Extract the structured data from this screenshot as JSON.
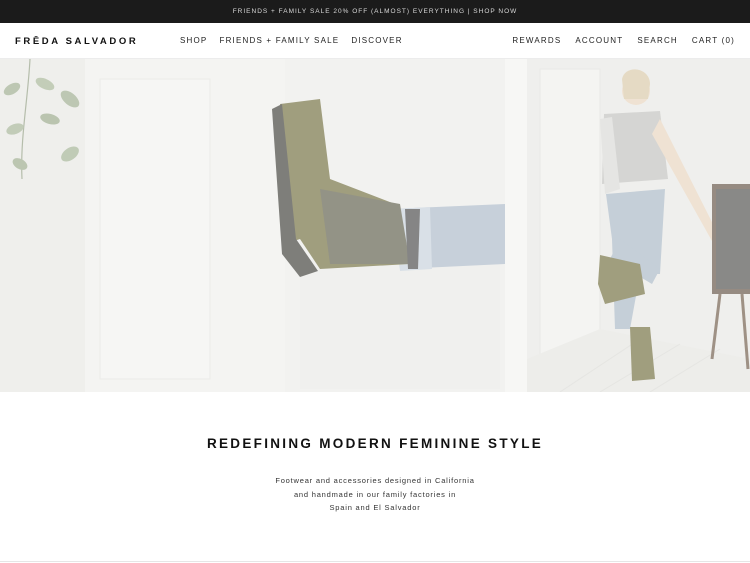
{
  "promo_banner": {
    "text": "FRIENDS + FAMILY SALE 20% OFF (ALMOST) EVERYTHING | SHOP NOW"
  },
  "header": {
    "logo": "FRĒDA SALVADOR",
    "nav_left": [
      {
        "label": "SHOP"
      },
      {
        "label": "FRIENDS + FAMILY SALE"
      },
      {
        "label": "DISCOVER"
      }
    ],
    "nav_right": [
      {
        "label": "REWARDS"
      },
      {
        "label": "ACCOUNT"
      },
      {
        "label": "SEARCH"
      },
      {
        "label": "CART (0)"
      }
    ]
  },
  "hero": {
    "image_subject": "boots-lifestyle-photo"
  },
  "main": {
    "headline": "REDEFINING MODERN FEMININE STYLE",
    "description_lines": [
      "Footwear and accessories designed in California",
      "and handmade in our family factories in",
      "Spain and El Salvador"
    ]
  },
  "colors": {
    "promo_bg": "#1b1b1b",
    "text": "#111111",
    "hero_bg": "#ececea",
    "boot_olive": "#6e6a3a"
  }
}
